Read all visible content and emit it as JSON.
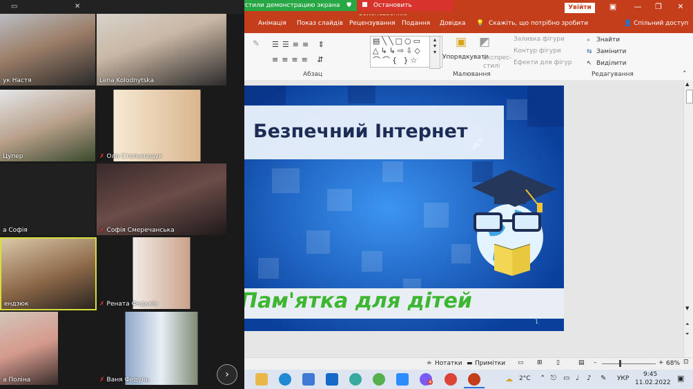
{
  "share_bar": {
    "message": "Вы запустили демонстрацию экрана",
    "stop_label": "Остановить демонстрацию"
  },
  "title_bar": {
    "signin": "Увійти",
    "minimize": "—",
    "restore": "❐",
    "close": "✕"
  },
  "ribbon": {
    "tabs": [
      "Анімація",
      "Показ слайдів",
      "Рецензування",
      "Подання",
      "Довідка"
    ],
    "tell_me": "Скажіть, що потрібно зробити",
    "share": "Спільний доступ",
    "groups": {
      "paragraph": "Абзац",
      "drawing": "Малювання",
      "editing": "Редагування"
    },
    "arrange": "Упорядкувати",
    "quick_styles": "Експрес-\nстилі",
    "shape_fill": "Заливка фігури",
    "shape_outline": "Контур фігури",
    "shape_effects": "Ефекти для фігур",
    "find": "Знайти",
    "replace": "Замінити",
    "select": "Виділити"
  },
  "slide": {
    "title": "Безпечний Інтернет",
    "subtitle": "Пам'ятка для дітей",
    "number": "1"
  },
  "statusbar": {
    "notes": "Нотатки",
    "comments": "Примітки",
    "zoom": "68%"
  },
  "participants": [
    "ук Настя",
    "Lena Kolodnytska",
    "Цупер",
    "Оля Стельмащук",
    "а Софія",
    "Софія Смеречанська",
    "ендзюк",
    "Рената Федьків",
    "а Поліна",
    "Ваня Федунь"
  ],
  "taskbar": {
    "weather": "2°C",
    "language": "УКР",
    "time": "9:45",
    "date": "11.02.2022",
    "chrome_badge": "4"
  },
  "colors": {
    "ppt_red": "#c43e1c",
    "share_green": "#27a844",
    "stop_red": "#d8342b",
    "slide_blue": "#1266d6",
    "subtitle_green": "#3db631"
  }
}
